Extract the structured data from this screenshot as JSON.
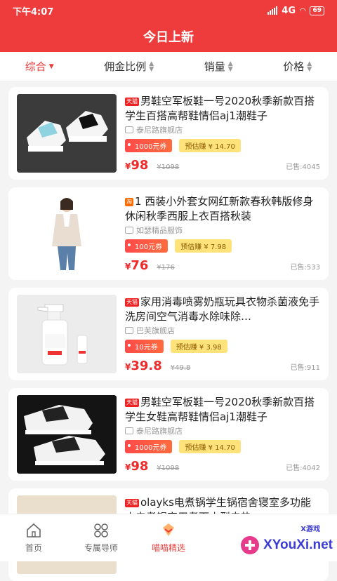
{
  "status": {
    "time": "下午4:07",
    "network": "4G",
    "battery": "69"
  },
  "header": {
    "title": "今日上新"
  },
  "sort": [
    {
      "label": "综合",
      "active": true
    },
    {
      "label": "佣金比例",
      "active": false
    },
    {
      "label": "销量",
      "active": false
    },
    {
      "label": "价格",
      "active": false
    }
  ],
  "products": [
    {
      "platform": "天猫",
      "title": "男鞋空军板鞋一号2020秋季新款百搭学生百搭高帮鞋情侣aj1潮鞋子",
      "shop": "泰尼路旗舰店",
      "coupon": "1000元券",
      "earn": "预估赚 ¥ 14.70",
      "price_symbol": "¥",
      "price": "98",
      "original": "¥1098",
      "sold": "已售:4045",
      "image": "sneaker-blue"
    },
    {
      "platform": "淘",
      "title": "1 西装小外套女网红新款春秋韩版修身休闲秋季西服上衣百搭秋装",
      "shop": "如瑟精品服饰",
      "coupon": "100元券",
      "earn": "预估赚 ¥ 7.98",
      "price_symbol": "¥",
      "price": "76",
      "original": "¥176",
      "sold": "已售:533",
      "image": "woman-blazer"
    },
    {
      "platform": "天猫",
      "title": "家用消毒喷雾奶瓶玩具衣物杀菌液免手洗房间空气消毒水除味除…",
      "shop": "巴芙旗舰店",
      "coupon": "10元券",
      "earn": "预估赚 ¥ 3.98",
      "price_symbol": "¥",
      "price": "39.8",
      "original": "¥49.8",
      "sold": "已售:911",
      "image": "spray-bottle"
    },
    {
      "platform": "天猫",
      "title": "男鞋空军板鞋一号2020秋季新款百搭学生女鞋高帮鞋情侣aj1潮鞋子",
      "shop": "泰尼路旗舰店",
      "coupon": "1000元券",
      "earn": "预估赚 ¥ 14.70",
      "price_symbol": "¥",
      "price": "98",
      "original": "¥1098",
      "sold": "已售:4042",
      "image": "sneaker-black"
    },
    {
      "platform": "天猫",
      "title": "olayks电煮锅学生锅宿舍寝室多功能小电煮锅家用煮面小型电热",
      "shop": "",
      "coupon": "",
      "earn": "",
      "price_symbol": "",
      "price": "",
      "original": "",
      "sold": "",
      "image": "cooker"
    }
  ],
  "tabs": [
    {
      "label": "首页",
      "icon": "home-icon",
      "active": false
    },
    {
      "label": "专属导师",
      "icon": "grid-icon",
      "active": false
    },
    {
      "label": "喵喵精选",
      "icon": "selection-icon",
      "active": true
    },
    {
      "label": "",
      "icon": "",
      "active": false
    },
    {
      "label": "",
      "icon": "",
      "active": false
    }
  ],
  "watermark": {
    "text": "XYouXi.net",
    "small": "X游戏"
  },
  "colors": {
    "primary": "#ee3b3b",
    "earn_bg": "#ffe37a"
  }
}
